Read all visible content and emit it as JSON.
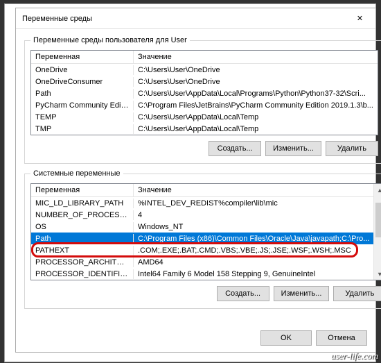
{
  "window": {
    "title": "Переменные среды",
    "close_icon": "✕"
  },
  "user_box": {
    "legend": "Переменные среды пользователя для User",
    "col_var": "Переменная",
    "col_val": "Значение",
    "rows": [
      {
        "var": "OneDrive",
        "val": "C:\\Users\\User\\OneDrive"
      },
      {
        "var": "OneDriveConsumer",
        "val": "C:\\Users\\User\\OneDrive"
      },
      {
        "var": "Path",
        "val": "C:\\Users\\User\\AppData\\Local\\Programs\\Python\\Python37-32\\Scri..."
      },
      {
        "var": "PyCharm Community Edition",
        "val": "C:\\Program Files\\JetBrains\\PyCharm Community Edition 2019.1.3\\b..."
      },
      {
        "var": "TEMP",
        "val": "C:\\Users\\User\\AppData\\Local\\Temp"
      },
      {
        "var": "TMP",
        "val": "C:\\Users\\User\\AppData\\Local\\Temp"
      }
    ],
    "btn_new": "Создать...",
    "btn_edit": "Изменить...",
    "btn_del": "Удалить"
  },
  "sys_box": {
    "legend": "Системные переменные",
    "col_var": "Переменная",
    "col_val": "Значение",
    "rows": [
      {
        "var": "MIC_LD_LIBRARY_PATH",
        "val": "%INTEL_DEV_REDIST%compiler\\lib\\mic"
      },
      {
        "var": "NUMBER_OF_PROCESSORS",
        "val": "4"
      },
      {
        "var": "OS",
        "val": "Windows_NT"
      },
      {
        "var": "Path",
        "val": "C:\\Program Files (x86)\\Common Files\\Oracle\\Java\\javapath;C:\\Pro...",
        "selected": true
      },
      {
        "var": "PATHEXT",
        "val": ".COM;.EXE;.BAT;.CMD;.VBS;.VBE;.JS;.JSE;.WSF;.WSH;.MSC"
      },
      {
        "var": "PROCESSOR_ARCHITECTURE",
        "val": "AMD64"
      },
      {
        "var": "PROCESSOR_IDENTIFIER",
        "val": "Intel64 Family 6 Model 158 Stepping 9, GenuineIntel"
      }
    ],
    "btn_new": "Создать...",
    "btn_edit": "Изменить...",
    "btn_del": "Удалить"
  },
  "dialog": {
    "ok": "OK",
    "cancel": "Отмена"
  },
  "watermark": "user-life.com"
}
